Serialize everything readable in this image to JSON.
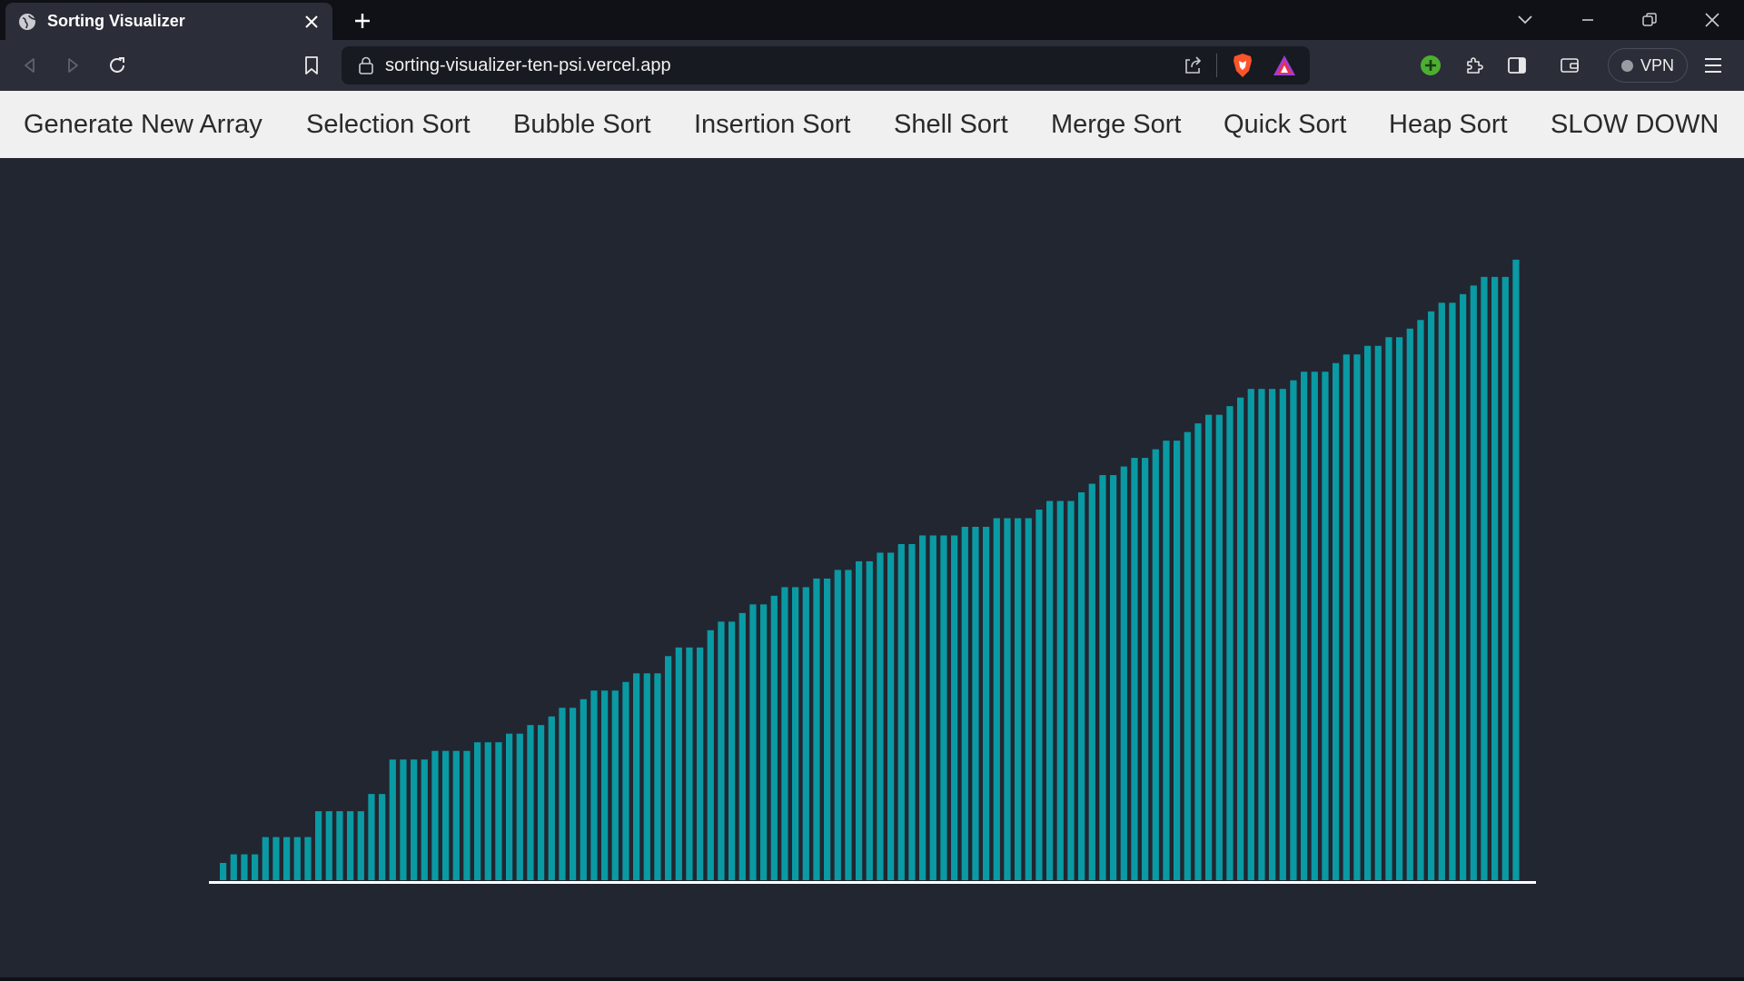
{
  "browser": {
    "tab_title": "Sorting Visualizer",
    "url": "sorting-visualizer-ten-psi.vercel.app",
    "vpn_label": "VPN"
  },
  "nav": {
    "items": [
      "Generate New Array",
      "Selection Sort",
      "Bubble Sort",
      "Insertion Sort",
      "Shell Sort",
      "Merge Sort",
      "Quick Sort",
      "Heap Sort",
      "SLOW DOWN"
    ]
  },
  "colors": {
    "bar": "#0a9aa3",
    "baseline": "#ffffff",
    "background": "#222631",
    "nav_background": "#f0f0f0"
  },
  "chart_data": {
    "type": "bar",
    "title": "",
    "xlabel": "",
    "ylabel": "",
    "sorted": true,
    "values": [
      20,
      30,
      30,
      30,
      50,
      50,
      50,
      50,
      50,
      80,
      80,
      80,
      80,
      80,
      100,
      100,
      140,
      140,
      140,
      140,
      150,
      150,
      150,
      150,
      160,
      160,
      160,
      170,
      170,
      180,
      180,
      190,
      200,
      200,
      210,
      220,
      220,
      220,
      230,
      240,
      240,
      240,
      260,
      270,
      270,
      270,
      290,
      300,
      300,
      310,
      320,
      320,
      330,
      340,
      340,
      340,
      350,
      350,
      360,
      360,
      370,
      370,
      380,
      380,
      390,
      390,
      400,
      400,
      400,
      400,
      410,
      410,
      410,
      420,
      420,
      420,
      420,
      430,
      440,
      440,
      440,
      450,
      460,
      470,
      470,
      480,
      490,
      490,
      500,
      510,
      510,
      520,
      530,
      540,
      540,
      550,
      560,
      570,
      570,
      570,
      570,
      580,
      590,
      590,
      590,
      600,
      610,
      610,
      620,
      620,
      630,
      630,
      640,
      650,
      660,
      670,
      670,
      680,
      690,
      700,
      700,
      700,
      720
    ]
  }
}
